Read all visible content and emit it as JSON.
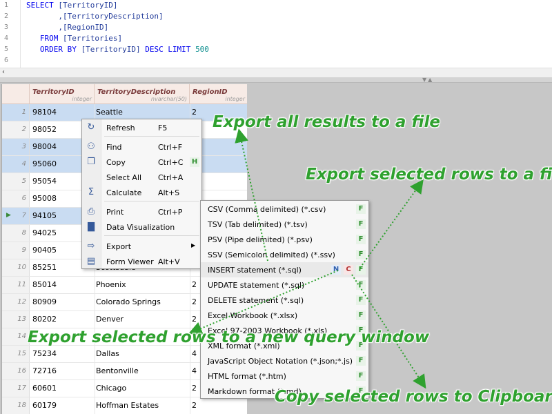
{
  "editor": {
    "line_numbers": [
      "1",
      "2",
      "3",
      "4",
      "5",
      "6"
    ],
    "lines": [
      [
        {
          "t": "SELECT",
          "k": "kw"
        },
        {
          "t": " [TerritoryID]",
          "k": "plain"
        }
      ],
      [
        {
          "t": "       ,[TerritoryDescription]",
          "k": "plain"
        }
      ],
      [
        {
          "t": "       ,[RegionID]",
          "k": "plain"
        }
      ],
      [
        {
          "t": "   FROM",
          "k": "kw"
        },
        {
          "t": " [Territories]",
          "k": "plain"
        }
      ],
      [
        {
          "t": "   ORDER BY",
          "k": "kw"
        },
        {
          "t": " [TerritoryID] ",
          "k": "plain"
        },
        {
          "t": "DESC LIMIT",
          "k": "kw"
        },
        {
          "t": " ",
          "k": "plain"
        },
        {
          "t": "500",
          "k": "num"
        }
      ],
      []
    ]
  },
  "grid": {
    "columns": [
      {
        "name": "TerritoryID",
        "type": "integer"
      },
      {
        "name": "TerritoryDescription",
        "type": "nvarchar(50)"
      },
      {
        "name": "RegionID",
        "type": "integer"
      }
    ],
    "rows": [
      {
        "n": "1",
        "id": "98104",
        "desc": "Seattle",
        "region": "2",
        "sel": true
      },
      {
        "n": "2",
        "id": "98052",
        "desc": "",
        "region": "",
        "sel": false
      },
      {
        "n": "3",
        "id": "98004",
        "desc": "",
        "region": "",
        "sel": true
      },
      {
        "n": "4",
        "id": "95060",
        "desc": "",
        "region": "",
        "sel": true
      },
      {
        "n": "5",
        "id": "95054",
        "desc": "",
        "region": "",
        "sel": false
      },
      {
        "n": "6",
        "id": "95008",
        "desc": "",
        "region": "",
        "sel": false
      },
      {
        "n": "7",
        "id": "94105",
        "desc": "",
        "region": "",
        "sel": true
      },
      {
        "n": "8",
        "id": "94025",
        "desc": "",
        "region": "",
        "sel": false
      },
      {
        "n": "9",
        "id": "90405",
        "desc": "",
        "region": "",
        "sel": false
      },
      {
        "n": "10",
        "id": "85251",
        "desc": "Scottsdale",
        "region": "",
        "sel": false
      },
      {
        "n": "11",
        "id": "85014",
        "desc": "Phoenix",
        "region": "2",
        "sel": false
      },
      {
        "n": "12",
        "id": "80909",
        "desc": "Colorado Springs",
        "region": "2",
        "sel": false
      },
      {
        "n": "13",
        "id": "80202",
        "desc": "Denver",
        "region": "2",
        "sel": false
      },
      {
        "n": "14",
        "id": "",
        "desc": "",
        "region": "",
        "sel": false
      },
      {
        "n": "15",
        "id": "75234",
        "desc": "Dallas",
        "region": "4",
        "sel": false
      },
      {
        "n": "16",
        "id": "72716",
        "desc": "Bentonville",
        "region": "4",
        "sel": false
      },
      {
        "n": "17",
        "id": "60601",
        "desc": "Chicago",
        "region": "2",
        "sel": false
      },
      {
        "n": "18",
        "id": "60179",
        "desc": "Hoffman Estates",
        "region": "2",
        "sel": false
      }
    ]
  },
  "context_menu": {
    "items": [
      {
        "label": "Refresh",
        "shortcut": "F5",
        "icon": "refresh-icon",
        "badge": ""
      },
      {
        "label": "Find",
        "shortcut": "Ctrl+F",
        "icon": "binoculars-icon",
        "badge": ""
      },
      {
        "label": "Copy",
        "shortcut": "Ctrl+C",
        "icon": "copy-icon",
        "badge": "H"
      },
      {
        "label": "Select All",
        "shortcut": "Ctrl+A",
        "icon": "",
        "badge": ""
      },
      {
        "label": "Calculate",
        "shortcut": "Alt+S",
        "icon": "sigma-icon",
        "badge": ""
      },
      {
        "label": "Print",
        "shortcut": "Ctrl+P",
        "icon": "printer-icon",
        "badge": ""
      },
      {
        "label": "Data Visualization",
        "shortcut": "",
        "icon": "chart-icon",
        "badge": ""
      },
      {
        "label": "Export",
        "shortcut": "",
        "icon": "export-icon",
        "badge": "",
        "submenu": true
      },
      {
        "label": "Form Viewer",
        "shortcut": "Alt+V",
        "icon": "form-icon",
        "badge": ""
      }
    ]
  },
  "export_menu": {
    "items": [
      {
        "label": "CSV (Comma delimited) (*.csv)",
        "badges": [
          "F"
        ]
      },
      {
        "label": "TSV (Tab delimited) (*.tsv)",
        "badges": [
          "F"
        ]
      },
      {
        "label": "PSV (Pipe delimited) (*.psv)",
        "badges": [
          "F"
        ]
      },
      {
        "label": "SSV (Semicolon delimited) (*.ssv)",
        "badges": [
          "F"
        ]
      },
      {
        "label": "INSERT statement (*.sql)",
        "badges": [
          "N",
          "C",
          "F"
        ]
      },
      {
        "label": "UPDATE statement (*.sql)",
        "badges": [
          "F"
        ]
      },
      {
        "label": "DELETE statement (*.sql)",
        "badges": [
          "F"
        ]
      },
      {
        "label": "Excel Workbook (*.xlsx)",
        "badges": [
          "F"
        ]
      },
      {
        "label": "Excel 97-2003 Workbook (*.xls)",
        "badges": [
          "F"
        ]
      },
      {
        "label": "XML format (*.xml)",
        "badges": [
          "F"
        ]
      },
      {
        "label": "JavaScript Object Notation (*.json;*.js)",
        "badges": [
          "F"
        ]
      },
      {
        "label": "HTML format (*.htm)",
        "badges": [
          "F"
        ]
      },
      {
        "label": "Markdown format (*.md)",
        "badges": [
          "F"
        ]
      }
    ]
  },
  "annotations": {
    "export_all": "Export all results to a file",
    "export_selected_file": "Export selected rows to a file",
    "export_new_query": "Export selected rows to a new query window",
    "copy_clipboard": "Copy selected rows to Clipboard"
  },
  "colors": {
    "annotation_green": "#2fa12f",
    "selection_blue": "#c9dcf2",
    "keyword_blue": "#0000ee"
  }
}
